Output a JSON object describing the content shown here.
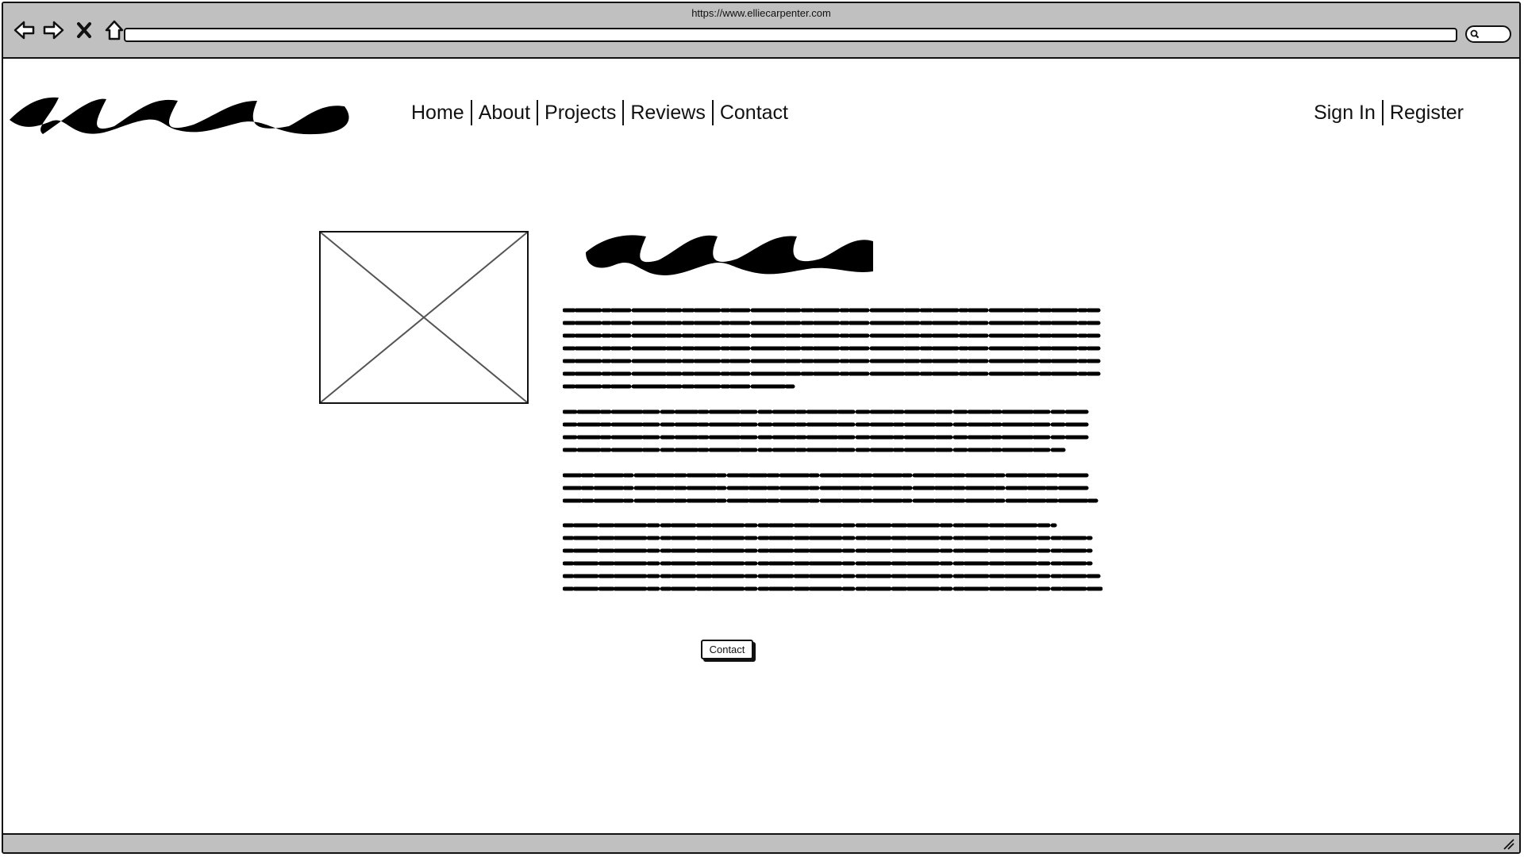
{
  "browser": {
    "url": "https://www.elliecarpenter.com",
    "icons": [
      "back-arrow-icon",
      "forward-arrow-icon",
      "close-x-icon",
      "home-icon",
      "search-icon",
      "resize-grip-icon"
    ]
  },
  "header": {
    "nav": [
      "Home",
      "About",
      "Projects",
      "Reviews",
      "Contact"
    ],
    "auth": [
      "Sign In",
      "Register"
    ]
  },
  "main": {
    "paragraph_line_counts": [
      7,
      4,
      3,
      6
    ],
    "contact_button": "Contact"
  }
}
